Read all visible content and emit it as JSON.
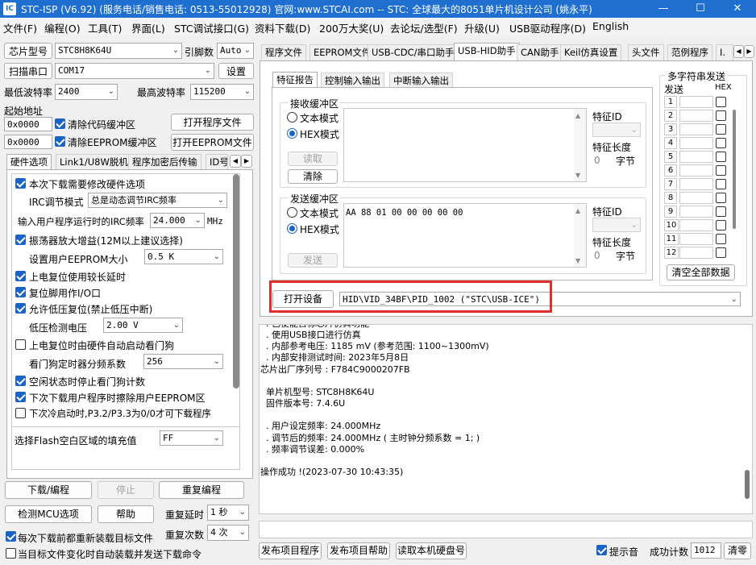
{
  "window": {
    "title": "STC-ISP (V6.92) (服务电话/销售电话: 0513-55012928) 官网:www.STCAI.com  -- STC: 全球最大的8051单片机设计公司 (姚永平)",
    "min": "—",
    "max": "☐",
    "close": "✕"
  },
  "menu": [
    "文件(F)",
    "编程(O)",
    "工具(T)",
    "界面(L)",
    "STC调试接口(G)",
    "资料下载(D)",
    "200万大奖(U)",
    "去论坛/选型(F)",
    "升级(U)",
    "USB驱动程序(D)",
    "English"
  ],
  "left": {
    "chip_label": "芯片型号",
    "chip_value": "STC8H8K64U",
    "pin_label": "引脚数",
    "pin_value": "Auto",
    "scan_label": "扫描串口",
    "port_value": "COM17",
    "settings_label": "设置",
    "min_baud_label": "最低波特率",
    "min_baud_value": "2400",
    "max_baud_label": "最高波特率",
    "max_baud_value": "115200",
    "start_addr_label": "起始地址",
    "addr1": "0x0000",
    "clear_code_label": "清除代码缓冲区",
    "open_prog_label": "打开程序文件",
    "addr2": "0x0000",
    "clear_eeprom_label": "清除EEPROM缓冲区",
    "open_eeprom_label": "打开EEPROM文件",
    "tabs": [
      "硬件选项",
      "Link1/U8W脱机",
      "程序加密后传输",
      "ID号"
    ],
    "opt_irc_label": "本次下载需要修改硬件选项",
    "irc_mode_label": "IRC调节模式",
    "irc_mode_value": "总是动态调节IRC频率",
    "irc_freq_label": "输入用户程序运行时的IRC频率",
    "irc_freq_value": "24.000",
    "irc_unit": "MHz",
    "osc_gain_label": "振荡器放大增益(12M以上建议选择)",
    "eeprom_size_label": "设置用户EEPROM大小",
    "eeprom_size_value": "0.5 K",
    "por_delay_label": "上电复位使用较长延时",
    "reset_pin_label": "复位脚用作I/O口",
    "lvr_label": "允许低压复位(禁止低压中断)",
    "lvd_label": "低压检测电压",
    "lvd_value": "2.00 V",
    "wdt_label": "上电复位时由硬件自动启动看门狗",
    "wdt_div_label": "看门狗定时器分频系数",
    "wdt_div_value": "256",
    "idle_wdt_label": "空闲状态时停止看门狗计数",
    "erase_eeprom_label": "下次下载用户程序时擦除用户EEPROM区",
    "cold_boot_label": "下次冷启动时,P3.2/P3.3为0/0才可下载程序",
    "fill_label": "选择Flash空白区域的填充值",
    "fill_value": "FF",
    "download_label": "下载/编程",
    "stop_label": "停止",
    "reprogram_label": "重复编程",
    "detect_label": "检测MCU选项",
    "help_label": "帮助",
    "repeat_delay_label": "重复延时",
    "repeat_delay_value": "1 秒",
    "reload_label": "每次下载前都重新装载目标文件",
    "repeat_count_label": "重复次数",
    "repeat_count_value": "4 次",
    "auto_load_label": "当目标文件变化时自动装载并发送下载命令"
  },
  "right": {
    "tabs": [
      "程序文件",
      "EEPROM文件",
      "USB-CDC/串口助手",
      "USB-HID助手",
      "CAN助手",
      "Keil仿真设置",
      "头文件",
      "范例程序",
      "I."
    ],
    "subtabs": [
      "特征报告",
      "控制输入输出",
      "中断输入输出"
    ],
    "recv_title": "接收缓冲区",
    "text_mode": "文本模式",
    "hex_mode": "HEX模式",
    "read_label": "读取",
    "clear_label": "清除",
    "feature_id_label": "特征ID",
    "feature_len_label": "特征长度",
    "feature_len_value": "0",
    "bytes_unit": "字节",
    "send_title": "发送缓冲区",
    "send_data": "AA 88 01 00 00 00 00 00",
    "send_label": "发送",
    "multi_title": "多字符串发送",
    "multi_send_col": "发送",
    "multi_hex_col": "HEX",
    "multi_rows": [
      "1",
      "2",
      "3",
      "4",
      "5",
      "6",
      "7",
      "8",
      "9",
      "10",
      "11",
      "12"
    ],
    "clear_all_label": "清空全部数据",
    "open_device_label": "打开设备",
    "device_value": "HID\\VID_34BF\\PID_1002 (\"STC\\USB-ICE\")",
    "log_lines": [
      "  . 已使能目标芯片仿真功能",
      "  . 使用USB接口进行仿真",
      "  . 内部参考电压: 1185 mV (参考范围: 1100~1300mV)",
      "  . 内部安排测试时间: 2023年5月8日",
      "芯片出厂序列号 : F784C9000207FB",
      "",
      "  单片机型号: STC8H8K64U",
      "  固件版本号: 7.4.6U",
      "",
      "  . 用户设定频率: 24.000MHz",
      "  . 调节后的频率: 24.000MHz ( 主时钟分频系数 = 1; )",
      "  . 频率调节误差: 0.000%",
      "",
      "操作成功 !(2023-07-30 10:43:35)"
    ],
    "publish_label": "发布项目程序",
    "publish_help_label": "发布项目帮助",
    "read_disk_label": "读取本机硬盘号",
    "beep_label": "提示音",
    "success_count_label": "成功计数",
    "success_count_value": "1012",
    "clear_count_label": "清零"
  },
  "colors": {
    "titlebar": "#1f6fd0",
    "highlight": "#e0302b",
    "check": "#1a64c8"
  }
}
